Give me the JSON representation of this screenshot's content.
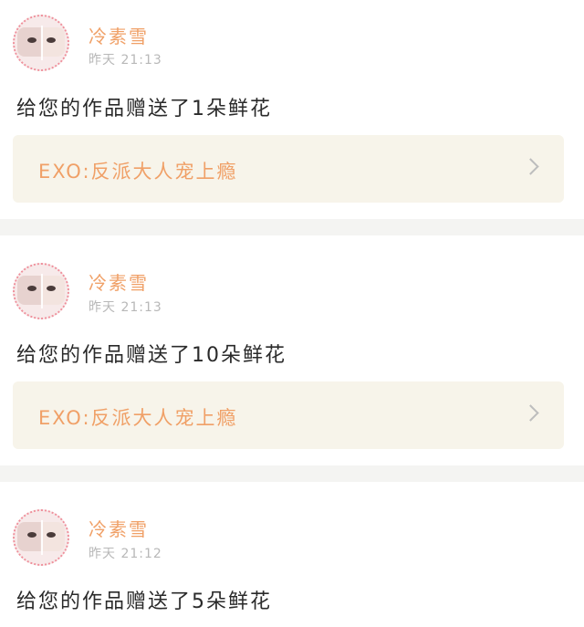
{
  "notifications": [
    {
      "user_name": "冷素雪",
      "time": "昨天 21:13",
      "message": "给您的作品赠送了1朵鲜花",
      "work_title": "EXO:反派大人宠上瘾"
    },
    {
      "user_name": "冷素雪",
      "time": "昨天 21:13",
      "message": "给您的作品赠送了10朵鲜花",
      "work_title": "EXO:反派大人宠上瘾"
    },
    {
      "user_name": "冷素雪",
      "time": "昨天 21:12",
      "message": "给您的作品赠送了5朵鲜花",
      "work_title": ""
    }
  ],
  "colors": {
    "accent": "#f0a067",
    "card_background": "#f7f4ea",
    "divider": "#f4f4f2",
    "meta_text": "#b8b8b8",
    "body_text": "#2a2a2a"
  },
  "icons": {
    "chevron": "chevron-right-icon",
    "avatar": "avatar-image"
  }
}
